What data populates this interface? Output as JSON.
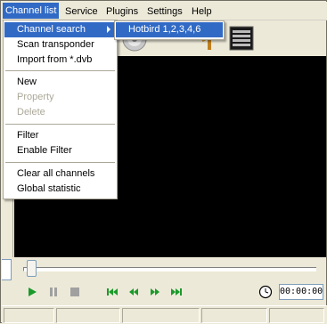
{
  "menubar": {
    "items": [
      {
        "label": "Channel list"
      },
      {
        "label": "Service"
      },
      {
        "label": "Plugins"
      },
      {
        "label": "Settings"
      },
      {
        "label": "Help"
      }
    ]
  },
  "dropdown": {
    "items": [
      {
        "label": "Channel search"
      },
      {
        "label": "Scan transponder"
      },
      {
        "label": "Import from *.dvb"
      },
      {
        "label": "New"
      },
      {
        "label": "Property"
      },
      {
        "label": "Delete"
      },
      {
        "label": "Filter"
      },
      {
        "label": "Enable Filter"
      },
      {
        "label": "Clear all channels"
      },
      {
        "label": "Global statistic"
      }
    ]
  },
  "submenu": {
    "items": [
      {
        "label": "Hotbird 1,2,3,4,6"
      }
    ]
  },
  "player": {
    "time": "00:00:00"
  },
  "colors": {
    "highlight": "#316ac5",
    "menu_background": "#ece9d8",
    "video_background": "#000000",
    "control_green": "#1a9a2a"
  },
  "icons": [
    "cd-icon",
    "satellite-dish-icon",
    "tv-guide-icon",
    "play-icon",
    "pause-icon",
    "stop-icon",
    "skip-back-icon",
    "rewind-icon",
    "forward-icon",
    "skip-forward-icon",
    "clock-icon"
  ]
}
